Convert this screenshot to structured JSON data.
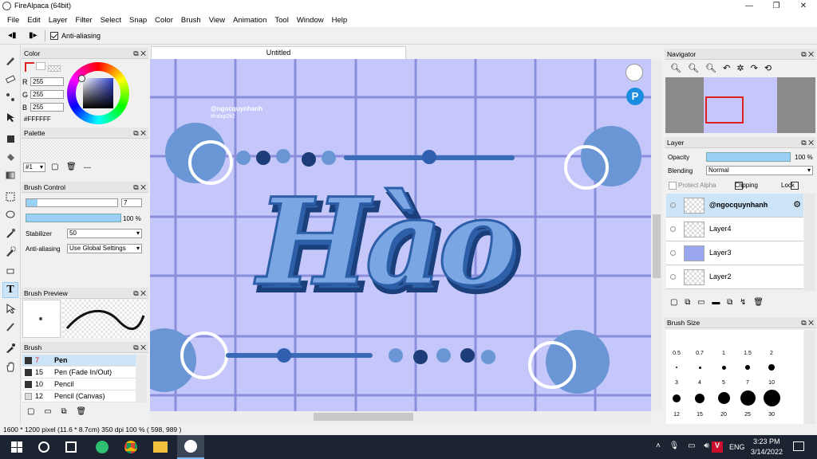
{
  "window": {
    "title": "FireAlpaca (64bit)",
    "controls": [
      "—",
      "❐",
      "✕"
    ]
  },
  "menu": [
    "File",
    "Edit",
    "Layer",
    "Filter",
    "Select",
    "Snap",
    "Color",
    "Brush",
    "View",
    "Animation",
    "Tool",
    "Window",
    "Help"
  ],
  "options": {
    "antialias_label": "Anti-aliasing"
  },
  "color_panel": {
    "title": "Color",
    "r": "255",
    "g": "255",
    "b": "255",
    "hex": "#FFFFFF",
    "r_label": "R",
    "g_label": "G",
    "b_label": "B"
  },
  "palette_panel": {
    "title": "Palette",
    "selector": "#1",
    "dashes": "---"
  },
  "brush_control": {
    "title": "Brush Control",
    "size": "7",
    "opacity": "100 %",
    "stabilizer_label": "Stabilizer",
    "stabilizer_value": "50",
    "antialias_label": "Anti-aliasing",
    "antialias_value": "Use Global Settings"
  },
  "brush_preview": {
    "title": "Brush Preview"
  },
  "brush_panel": {
    "title": "Brush",
    "items": [
      {
        "num": "7",
        "name": "Pen"
      },
      {
        "num": "15",
        "name": "Pen (Fade In/Out)"
      },
      {
        "num": "10",
        "name": "Pencil"
      },
      {
        "num": "12",
        "name": "Pencil (Canvas)"
      }
    ]
  },
  "document": {
    "tab": "Untitled"
  },
  "artwork": {
    "watermark_line1": "@ngocquynhanh",
    "watermark_line2": "#hdap2k2",
    "title_text": "Hào"
  },
  "navigator": {
    "title": "Navigator"
  },
  "layer_panel": {
    "title": "Layer",
    "opacity_label": "Opacity",
    "opacity_value": "100 %",
    "blending_label": "Blending",
    "blending_value": "Normal",
    "protect_alpha": "Protect Alpha",
    "clipping": "Clipping",
    "lock": "Lock",
    "layers": [
      "@ngocquynhanh",
      "Layer4",
      "Layer3",
      "Layer2"
    ]
  },
  "brush_size": {
    "title": "Brush Size",
    "row1": [
      "0.5",
      "0.7",
      "1",
      "1.5",
      "2"
    ],
    "row2": [
      "3",
      "4",
      "5",
      "7",
      "10"
    ],
    "row3": [
      "12",
      "15",
      "20",
      "25",
      "30"
    ]
  },
  "status": {
    "text": "1600 * 1200 pixel   (11.6 * 8.7cm)   350 dpi   100 %   ( 598, 989 )"
  },
  "taskbar": {
    "time": "3:23 PM",
    "date": "3/14/2022",
    "lang": "ENG"
  },
  "colors": {
    "canvas": "#c5c6fa",
    "accent_blue": "#3a6bb8",
    "selection": "#cce4f7"
  }
}
